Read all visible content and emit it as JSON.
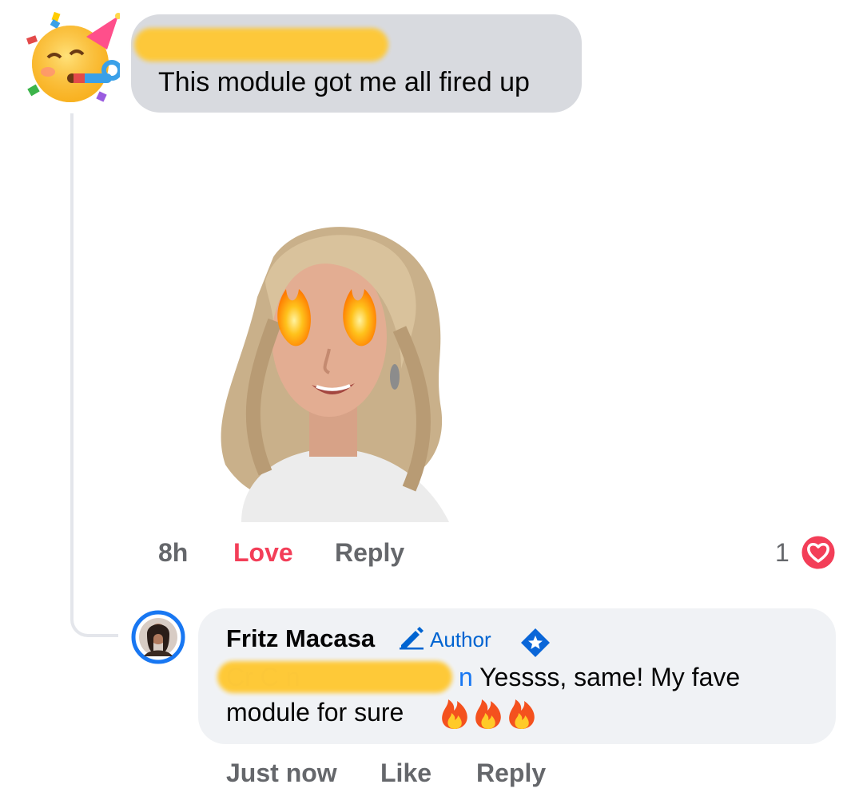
{
  "comment": {
    "author_redacted": true,
    "text": "This module got me all fired up",
    "avatar_icon": "partying-face-emoji-icon",
    "sticker_icon": "avatar-sticker-fire-eyes",
    "time": "8h",
    "reaction_label": "Love",
    "reply_label": "Reply",
    "reaction_count": "1",
    "reaction_icon": "love-heart-icon"
  },
  "reply": {
    "name": "Fritz Macasa",
    "badge_label": "Author",
    "badge_icon": "pencil-icon",
    "star_icon": "top-fan-star-icon",
    "mention_fragment": "n",
    "text_line1": "Yessss, same! My fave",
    "text_line2": "module for sure",
    "emoji_icon": "fire-emoji-icon",
    "time": "Just now",
    "like_label": "Like",
    "reply_label": "Reply"
  },
  "colors": {
    "love": "#f33e58",
    "author": "#0064d1",
    "redaction": "#ffc832",
    "bubble_top": "#d8dadf",
    "bubble_reply": "#f0f2f5",
    "muted": "#65676b"
  }
}
